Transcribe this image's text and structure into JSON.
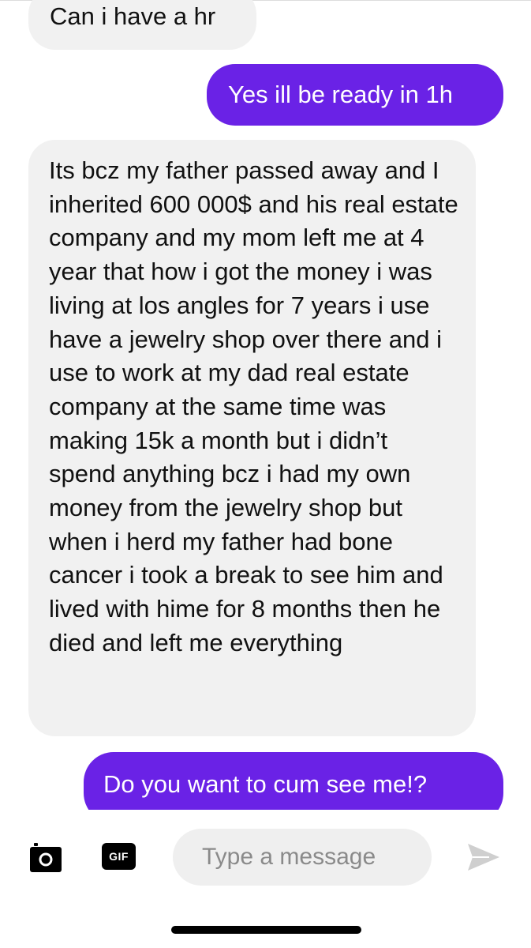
{
  "messages": [
    {
      "direction": "incoming",
      "text": "Can i have a hr"
    },
    {
      "direction": "outgoing",
      "text": "Yes ill be ready in 1h"
    },
    {
      "direction": "incoming",
      "text": "Its bcz my father passed away and I inherited 600 000$ and his real estate company and my mom left me at 4 year that how i got the money i was living at los angles for 7 years i use have a jewelry shop over there and i use to work at my dad real estate company at the same time was making 15k a month but i didn’t spend anything bcz i had my own money from the jewelry shop but when i herd my father had bone cancer i took a break to see him and lived with hime for 8 months then he died and left me everything"
    },
    {
      "direction": "outgoing",
      "text": "Do you want to cum see me!?"
    }
  ],
  "composer": {
    "camera_icon": "camera-icon",
    "gif_label": "GIF",
    "input_placeholder": "Type a message",
    "send_icon": "send-icon"
  },
  "colors": {
    "outgoing_bubble": "#6a22e6",
    "incoming_bubble": "#f1f1f1",
    "send_icon": "#cfcfcf"
  }
}
